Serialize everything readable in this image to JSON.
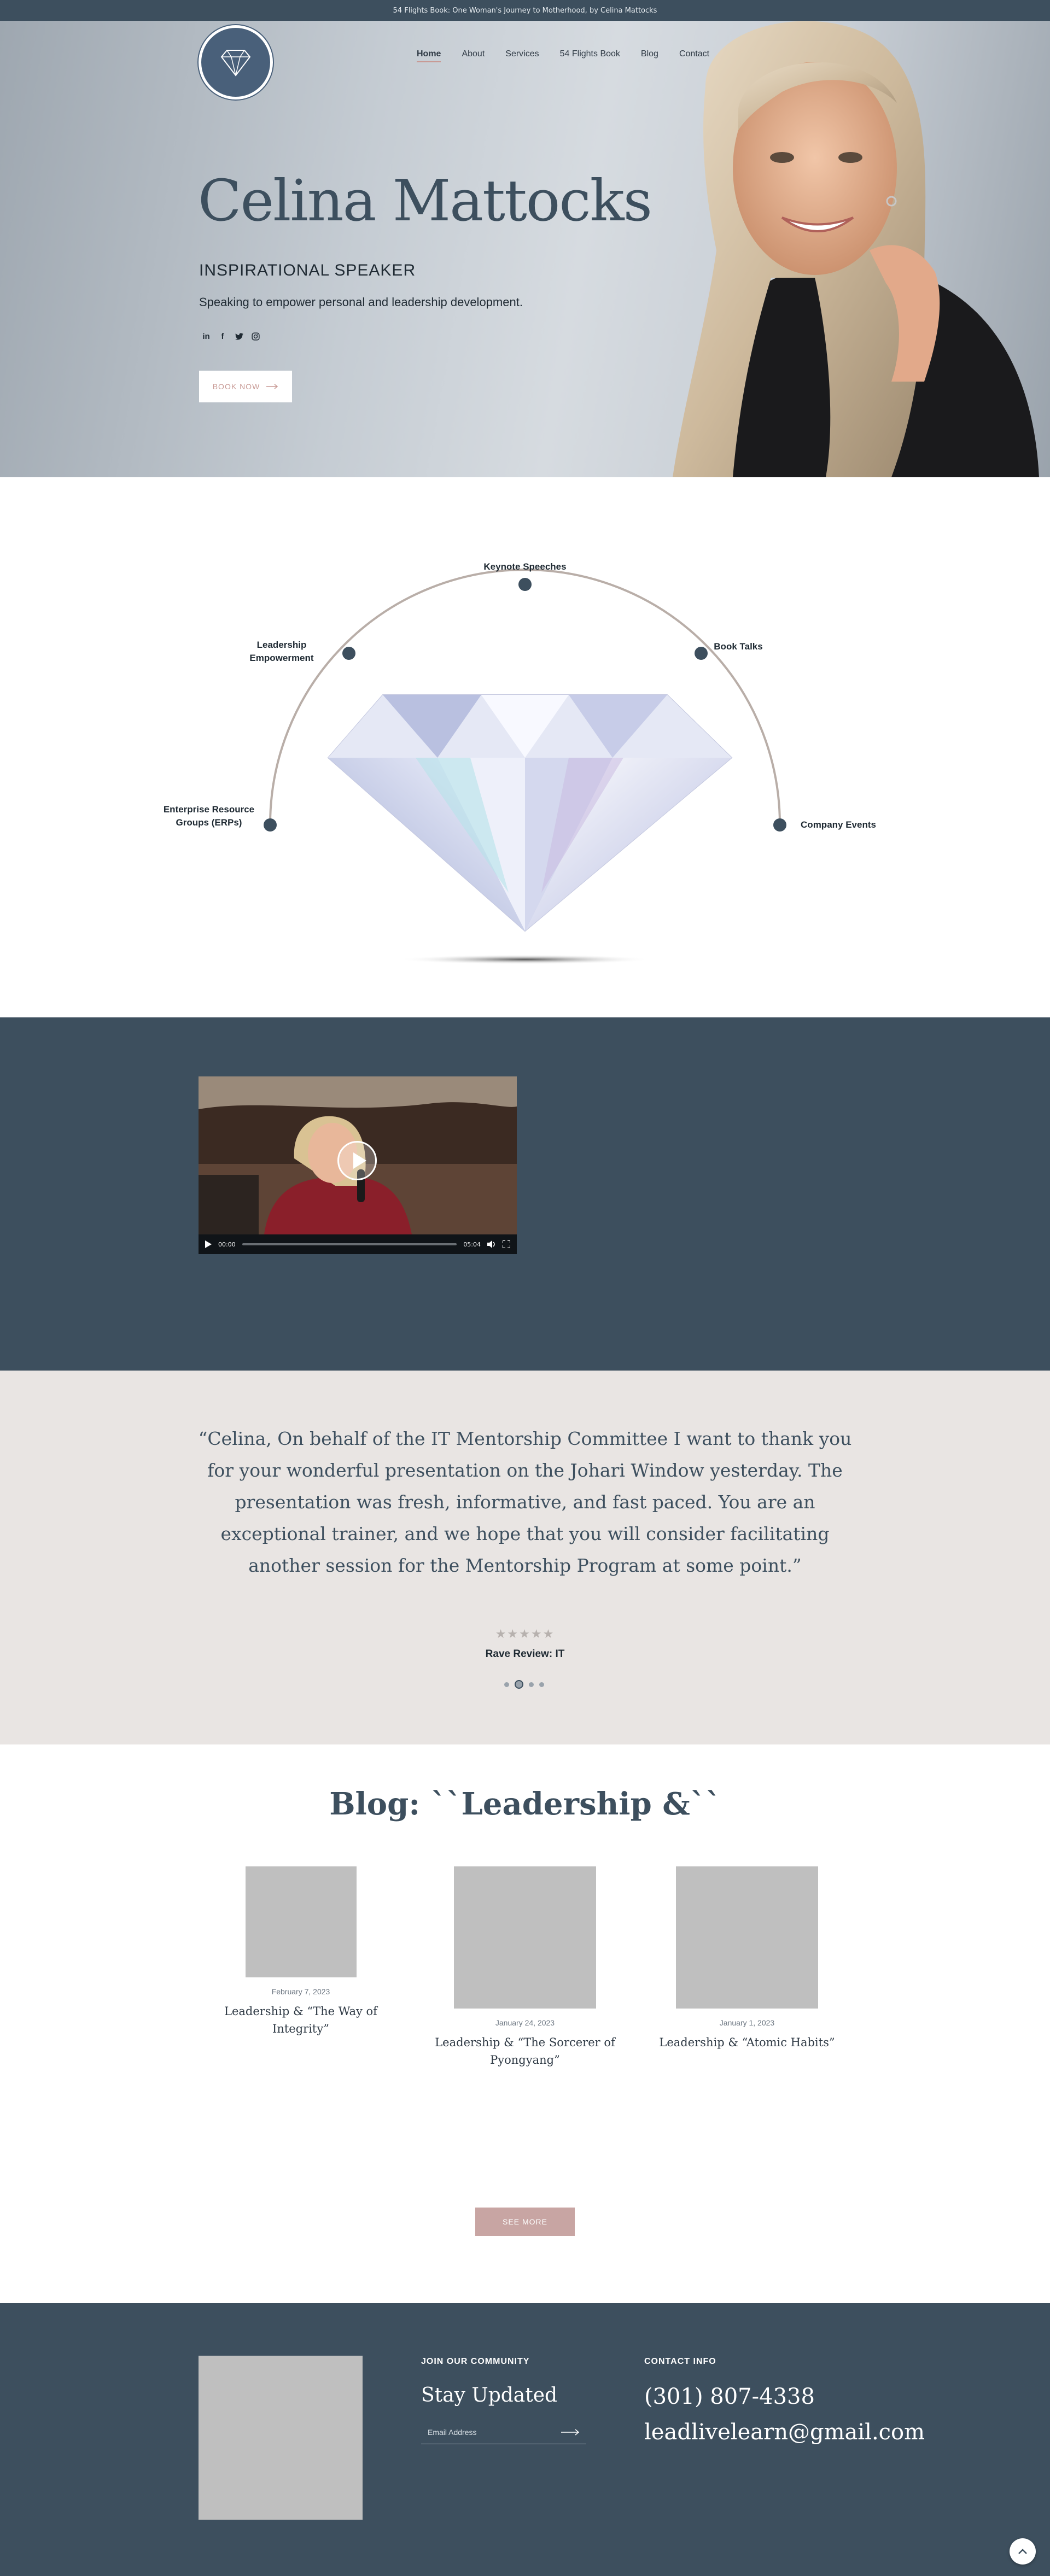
{
  "announcement": {
    "text": "54 Flights Book: One Woman's Journey to Motherhood, by Celina Mattocks"
  },
  "header": {
    "logo_alt": "Lead Live Learn",
    "nav": [
      {
        "label": "Home",
        "active": true
      },
      {
        "label": "About"
      },
      {
        "label": "Services"
      },
      {
        "label": "54 Flights Book"
      },
      {
        "label": "Blog"
      },
      {
        "label": "Contact"
      }
    ]
  },
  "hero": {
    "title": "Celina Mattocks",
    "subtitle": "INSPIRATIONAL SPEAKER",
    "tagline": "Speaking to empower personal and leadership development.",
    "socials": [
      "linkedin-icon",
      "facebook-icon",
      "twitter-icon",
      "instagram-icon"
    ],
    "cta": "BOOK NOW"
  },
  "services": {
    "items": [
      {
        "label": "Keynote Speeches"
      },
      {
        "label": "Leadership Empowerment"
      },
      {
        "label": "Book Talks"
      },
      {
        "label": "Enterprise Resource Groups (ERPs)"
      },
      {
        "label": "Company Events"
      }
    ]
  },
  "video": {
    "current_time": "00:00",
    "duration": "05:04"
  },
  "testimonial": {
    "quote": "“Celina, On behalf of the IT Mentorship Committee I want to thank you for your wonderful presentation on the Johari Window yesterday. The presentation was fresh, informative, and fast paced. You are an exceptional trainer, and we hope that you will consider facilitating another session for the Mentorship Program at some point.”",
    "stars": "★★★★★",
    "reviewer": "Rave Review: IT",
    "slides": 4,
    "active_slide": 2
  },
  "blog": {
    "title": "Blog: ``Leadership &``",
    "posts": [
      {
        "date": "February 7, 2023",
        "title": "Leadership & “The Way of Integrity”"
      },
      {
        "date": "January 24, 2023",
        "title": "Leadership & “The Sorcerer of Pyongyang”"
      },
      {
        "date": "January 1, 2023",
        "title": "Leadership & “Atomic Habits”"
      }
    ],
    "see_more": "SEE MORE"
  },
  "footer": {
    "community_heading": "JOIN OUR COMMUNITY",
    "stay_updated": "Stay Updated",
    "email_placeholder": "Email Address",
    "contact_heading": "CONTACT INFO",
    "phone": "(301) 807-4338",
    "email": "leadlivelearn@gmail.com"
  },
  "colors": {
    "navy": "#3d4f5e",
    "blush": "#c8a5a3",
    "bg_light": "#e9e5e3"
  }
}
